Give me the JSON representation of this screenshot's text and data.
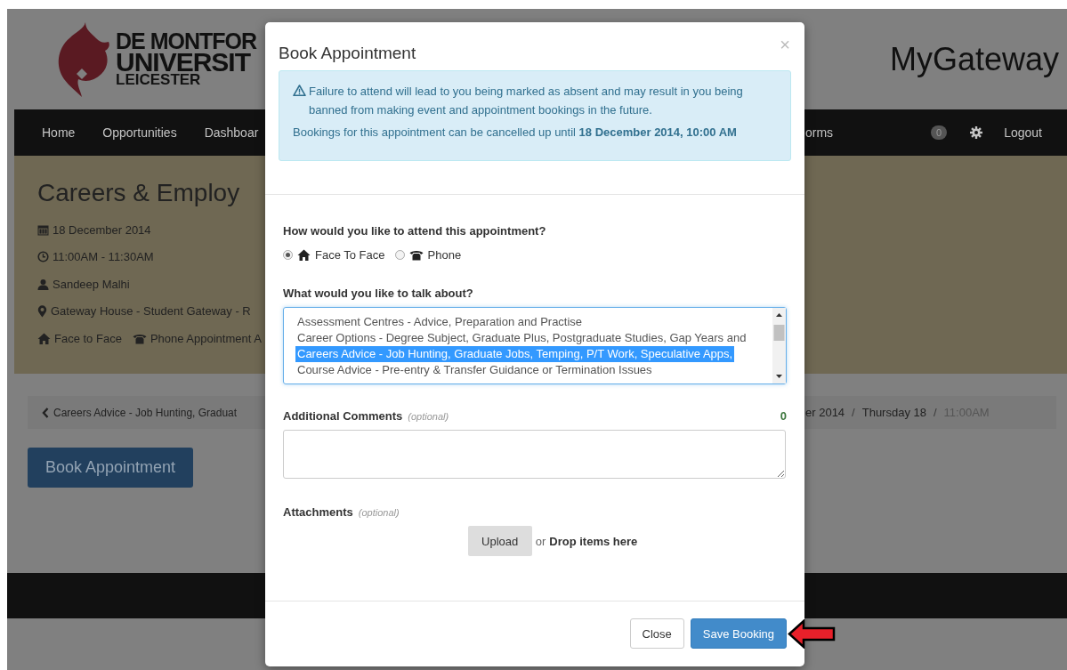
{
  "header": {
    "logo_lines": [
      "DE MONTFOR",
      "UNIVERSIT",
      "LEICESTER"
    ],
    "site_title": "MyGateway"
  },
  "nav": {
    "left_items": [
      {
        "label": "Home"
      },
      {
        "label": "Opportunities"
      },
      {
        "label": "Dashboar"
      }
    ],
    "right_fragment": "orms",
    "badge": "0",
    "logout": "Logout"
  },
  "event": {
    "title": "Careers & Employ",
    "details": [
      {
        "kind": "calendar",
        "text": "18 December 2014"
      },
      {
        "kind": "clock",
        "text": "11:00AM - 11:30AM"
      },
      {
        "kind": "person",
        "text": "Sandeep Malhi"
      },
      {
        "kind": "pin",
        "text": "Gateway House - Student Gateway - R"
      }
    ],
    "modes": [
      {
        "kind": "home",
        "text": "Face to Face"
      },
      {
        "kind": "phone",
        "text": "Phone Appointment A"
      }
    ]
  },
  "breadcrumb": {
    "back": "Careers Advice - Job Hunting, Graduat",
    "separator": "/",
    "items": [
      {
        "label": "er 2014",
        "active": false
      },
      {
        "label": "Thursday 18",
        "active": false
      },
      {
        "label": "11:00AM",
        "active": true
      }
    ]
  },
  "book_button": "Book Appointment",
  "modal": {
    "title": "Book Appointment",
    "close": "×",
    "alert": {
      "warning": "Failure to attend will lead to you being marked as absent and may result in you being banned from making event and appointment bookings in the future.",
      "cancel_note": "Bookings for this appointment can be cancelled up until **18 December 2014, 10:00 AM**"
    },
    "attend": {
      "question": "How would you like to attend this appointment?",
      "options": [
        {
          "kind": "home",
          "label": "Face To Face",
          "selected": true
        },
        {
          "kind": "phone",
          "label": "Phone",
          "selected": false
        }
      ]
    },
    "topics": {
      "question": "What would you like to talk about?",
      "items": [
        {
          "label": "Assessment Centres - Advice, Preparation and Practise",
          "selected": false
        },
        {
          "label": "Career Options - Degree Subject, Graduate Plus, Postgraduate Studies, Gap Years and",
          "selected": false
        },
        {
          "label": "Careers Advice - Job Hunting, Graduate Jobs, Temping, P/T Work, Speculative Apps,",
          "selected": true
        },
        {
          "label": "Course Advice - Pre-entry & Transfer Guidance or Termination Issues",
          "selected": false
        }
      ]
    },
    "comments": {
      "label": "Additional Comments",
      "hint": "(optional)",
      "count": "0"
    },
    "attachments": {
      "label": "Attachments",
      "hint": "(optional)",
      "upload": "Upload",
      "or": "or",
      "drop": "Drop items here"
    },
    "buttons": [
      {
        "kind": "default",
        "label": "Close"
      },
      {
        "kind": "primary",
        "label": "Save Booking"
      }
    ]
  }
}
